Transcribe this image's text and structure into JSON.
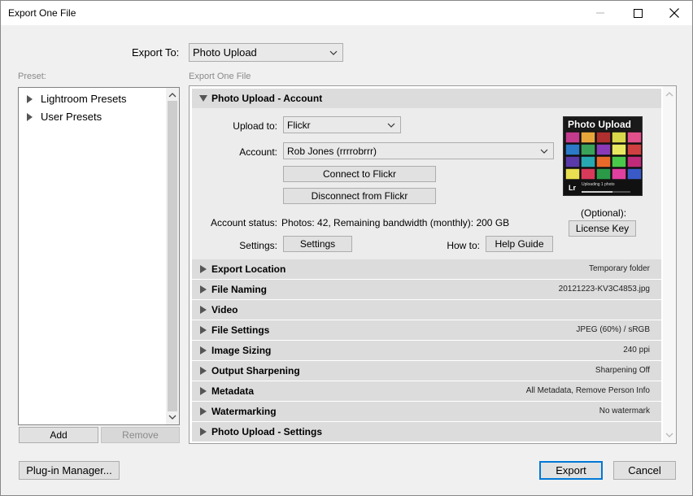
{
  "window": {
    "title": "Export One File"
  },
  "export_to": {
    "label": "Export To:",
    "value": "Photo Upload"
  },
  "preset": {
    "section_label": "Preset:",
    "items": [
      {
        "label": "Lightroom Presets"
      },
      {
        "label": "User Presets"
      }
    ],
    "add_label": "Add",
    "remove_label": "Remove"
  },
  "main": {
    "section_label": "Export One File",
    "account_section": {
      "title": "Photo Upload - Account",
      "upload_to_label": "Upload to:",
      "upload_to_value": "Flickr",
      "account_label": "Account:",
      "account_value": "Rob Jones (rrrrobrrr)",
      "connect_label": "Connect to Flickr",
      "disconnect_label": "Disconnect from Flickr",
      "account_status_label": "Account status:",
      "account_status_value": "Photos: 42, Remaining bandwidth (monthly): 200 GB",
      "settings_label": "Settings:",
      "settings_button": "Settings",
      "how_to_label": "How to:",
      "help_guide_button": "Help Guide",
      "thumbnail_title": "Photo Upload",
      "thumbnail_badge": "Lr",
      "thumbnail_caption": "Uploading 1 photo",
      "optional_label": "(Optional):",
      "license_key_button": "License Key"
    },
    "sections": [
      {
        "title": "Export Location",
        "summary": "Temporary folder"
      },
      {
        "title": "File Naming",
        "summary": "20121223-KV3C4853.jpg"
      },
      {
        "title": "Video",
        "summary": ""
      },
      {
        "title": "File Settings",
        "summary": "JPEG (60%) / sRGB"
      },
      {
        "title": "Image Sizing",
        "summary": "240 ppi"
      },
      {
        "title": "Output Sharpening",
        "summary": "Sharpening Off"
      },
      {
        "title": "Metadata",
        "summary": "All Metadata, Remove Person Info"
      },
      {
        "title": "Watermarking",
        "summary": "No watermark"
      },
      {
        "title": "Photo Upload - Settings",
        "summary": ""
      }
    ]
  },
  "footer": {
    "plugin_manager_label": "Plug-in Manager...",
    "export_label": "Export",
    "cancel_label": "Cancel"
  },
  "colors": {
    "accent": "#0078d7",
    "section_header_bg": "#dcdcdc"
  }
}
